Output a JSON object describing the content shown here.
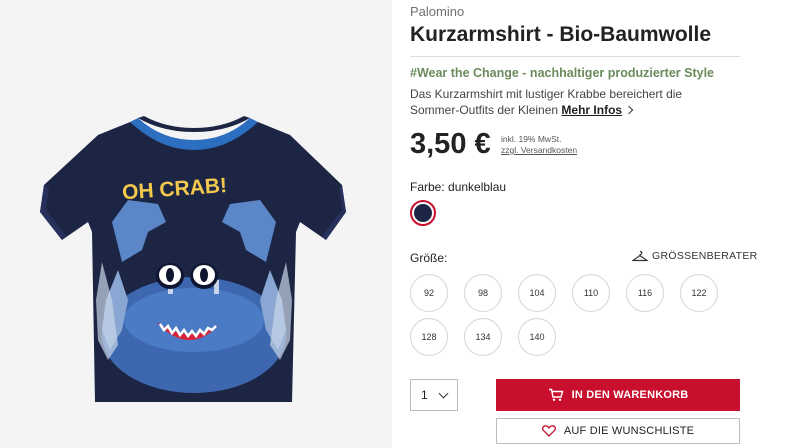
{
  "product": {
    "brand": "Palomino",
    "title": "Kurzarmshirt - Bio-Baumwolle",
    "hashtag": "#Wear the Change - nachhaltiger produzierter Style",
    "description": "Das Kurzarmshirt mit lustiger Krabbe bereichert die Sommer-Outfits der Kleinen",
    "more_link": "Mehr Infos",
    "image_print_text": "OH CRAB!"
  },
  "pricing": {
    "price": "3,50 €",
    "tax_note": "inkl. 19% MwSt.",
    "shipping_link": "zzgl. Versandkosten"
  },
  "color": {
    "label": "Farbe: dunkelblau",
    "swatch": "#1c2544"
  },
  "sizes": {
    "label": "Größe:",
    "guide_label": "GRÖSSENBERATER",
    "options": [
      "92",
      "98",
      "104",
      "110",
      "116",
      "122",
      "128",
      "134",
      "140"
    ]
  },
  "purchase": {
    "quantity": "1",
    "cart_label": "IN DEN WARENKORB",
    "wishlist_label": "AUF DIE WUNSCHLISTE"
  },
  "colors": {
    "accent": "#c8102e",
    "hashtag": "#6c8b5d",
    "shirt": "#1c2544",
    "collar": "#2c6fc0",
    "print_text": "#f2c94c"
  },
  "icons": [
    "chevron-right-icon",
    "hanger-icon",
    "chevron-down-icon",
    "cart-icon",
    "heart-icon"
  ]
}
